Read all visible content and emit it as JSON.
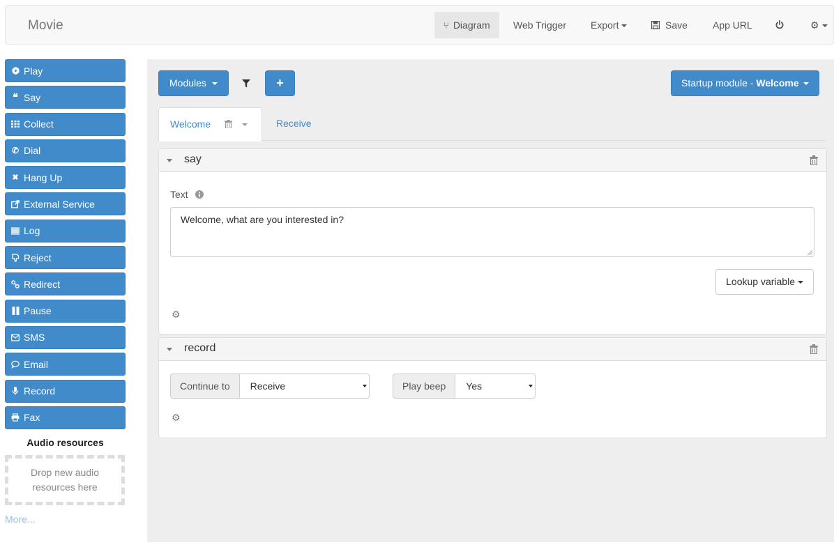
{
  "navbar": {
    "brand": "Movie",
    "items": [
      {
        "label": "Diagram",
        "icon": "diagram-icon",
        "active": true
      },
      {
        "label": "Web Trigger"
      },
      {
        "label": "Export",
        "dropdown": true
      },
      {
        "label": "Save",
        "icon": "save-icon"
      },
      {
        "label": "App URL"
      },
      {
        "label": "",
        "icon": "power-icon"
      },
      {
        "label": "",
        "icon": "gear-icon",
        "dropdown": true
      }
    ]
  },
  "sidebar": {
    "buttons": [
      {
        "label": "Play",
        "icon": "play-icon"
      },
      {
        "label": "Say",
        "icon": "quote-icon"
      },
      {
        "label": "Collect",
        "icon": "keypad-icon"
      },
      {
        "label": "Dial",
        "icon": "phone-icon"
      },
      {
        "label": "Hang Up",
        "icon": "close-icon"
      },
      {
        "label": "External Service",
        "icon": "external-link-icon"
      },
      {
        "label": "Log",
        "icon": "list-icon"
      },
      {
        "label": "Reject",
        "icon": "thumbs-down-icon"
      },
      {
        "label": "Redirect",
        "icon": "redirect-icon"
      },
      {
        "label": "Pause",
        "icon": "pause-icon"
      },
      {
        "label": "SMS",
        "icon": "envelope-icon"
      },
      {
        "label": "Email",
        "icon": "comment-icon"
      },
      {
        "label": "Record",
        "icon": "microphone-icon"
      },
      {
        "label": "Fax",
        "icon": "print-icon"
      }
    ],
    "audio_title": "Audio resources",
    "dropzone_text": "Drop new audio resources here",
    "more_link": "More..."
  },
  "toolbar": {
    "modules_label": "Modules",
    "add_label": "+",
    "startup_prefix": "Startup module - ",
    "startup_module": "Welcome"
  },
  "tabs": [
    {
      "label": "Welcome",
      "active": true
    },
    {
      "label": "Receive",
      "active": false
    }
  ],
  "say_panel": {
    "title": "say",
    "text_label": "Text",
    "text_value": "Welcome, what are you interested in?",
    "lookup_label": "Lookup variable"
  },
  "record_panel": {
    "title": "record",
    "continue_label": "Continue to",
    "continue_value": "Receive",
    "beep_label": "Play beep",
    "beep_value": "Yes"
  },
  "colors": {
    "primary": "#428bca",
    "navbar_bg": "#f8f8f8",
    "main_bg": "#eeeeee"
  }
}
